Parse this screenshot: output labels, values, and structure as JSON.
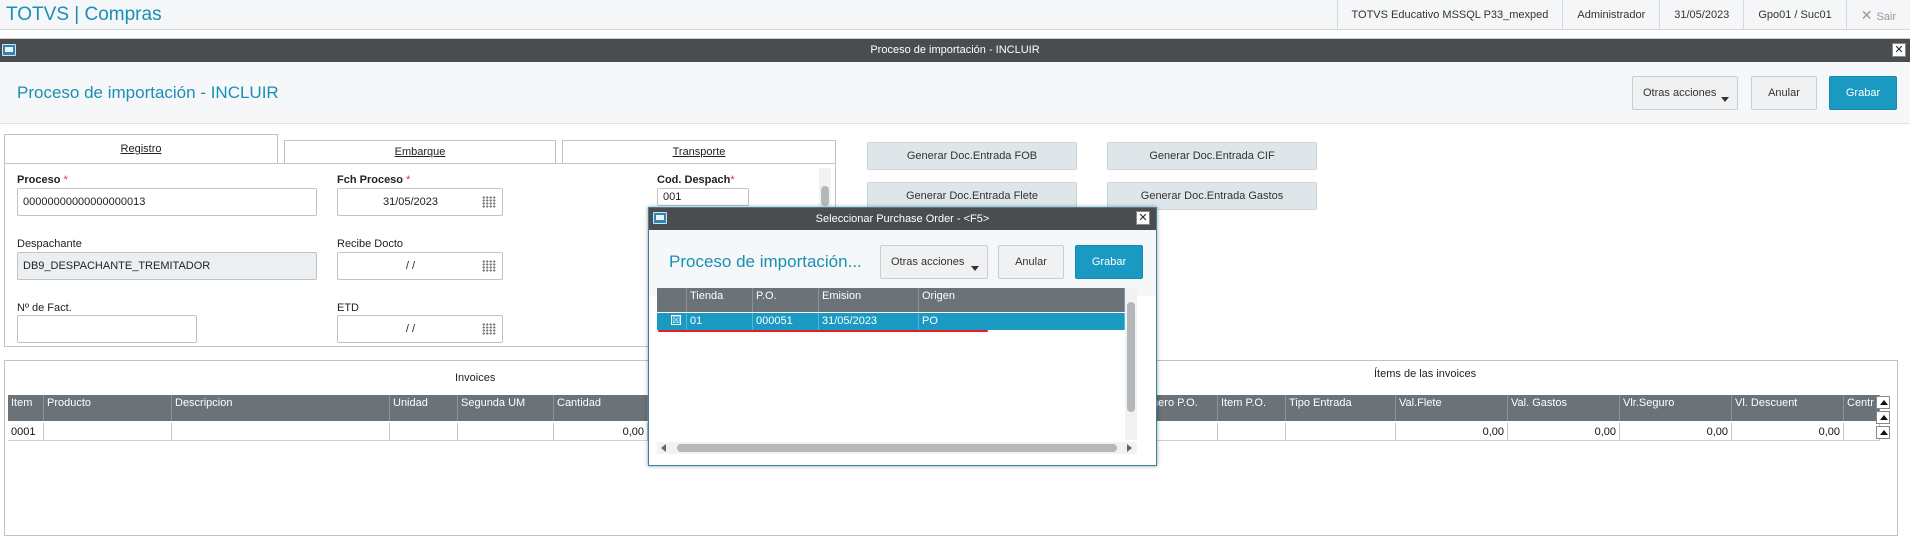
{
  "app": {
    "title": "TOTVS | Compras",
    "environment": "TOTVS Educativo MSSQL P33_mexped",
    "user": "Administrador",
    "date": "31/05/2023",
    "branch": "Gpo01 / Suc01",
    "logout_label": "Sair"
  },
  "window": {
    "title": "Proceso de importación - INCLUIR"
  },
  "header": {
    "title": "Proceso de importación - INCLUIR",
    "other_actions_label": "Otras acciones",
    "cancel_label": "Anular",
    "save_label": "Grabar"
  },
  "tabs": [
    {
      "label": "Registro"
    },
    {
      "label": "Embarque"
    },
    {
      "label": "Transporte"
    }
  ],
  "form": {
    "proceso_label": "Proceso",
    "proceso_value": "00000000000000000013",
    "fch_proceso_label": "Fch Proceso",
    "fch_proceso_value": "31/05/2023",
    "cod_despach_label": "Cod. Despach",
    "cod_despach_value": "001",
    "despachante_label": "Despachante",
    "despachante_value": "DB9_DESPACHANTE_TREMITADOR",
    "recibe_docto_label": "Recibe Docto",
    "recibe_docto_value": "/  /",
    "nro_fact_label": "Nº de Fact.",
    "nro_fact_value": "",
    "etd_label": "ETD",
    "etd_value": "/  /"
  },
  "actions": {
    "fob": "Generar Doc.Entrada FOB",
    "cif": "Generar Doc.Entrada CIF",
    "flete": "Generar Doc.Entrada Flete",
    "gastos": "Generar Doc.Entrada Gastos"
  },
  "invoices": {
    "section_label": "Invoices",
    "columns": [
      "Item",
      "Producto",
      "Descripcion",
      "Unidad",
      "Segunda UM",
      "Cantidad"
    ],
    "row": [
      "0001",
      "",
      "",
      "",
      "",
      "0,00"
    ]
  },
  "items": {
    "section_label": "Ítems de las invoices",
    "columns": [
      "mero P.O.",
      "Item P.O.",
      "Tipo Entrada",
      "Val.Flete",
      "Val. Gastos",
      "Vlr.Seguro",
      "Vl. Descuent",
      "Centr"
    ],
    "row": [
      "",
      "",
      "",
      "0,00",
      "0,00",
      "0,00",
      "0,00",
      ""
    ]
  },
  "dialog": {
    "window_title": "Seleccionar Purchase Order - <F5>",
    "title": "Proceso de importación...",
    "other_actions_label": "Otras acciones",
    "cancel_label": "Anular",
    "save_label": "Grabar",
    "columns": [
      "",
      "Tienda",
      "P.O.",
      "Emision",
      "Origen"
    ],
    "row": {
      "checked": "☒",
      "tienda": "01",
      "po": "000051",
      "emision": "31/05/2023",
      "origen": "PO"
    }
  },
  "colors": {
    "accent": "#1a8fb5",
    "primary_button": "#1a9ac2",
    "title_bar": "#4a4d50",
    "grid_header": "#6b7378",
    "highlight_line": "#e21f26"
  }
}
